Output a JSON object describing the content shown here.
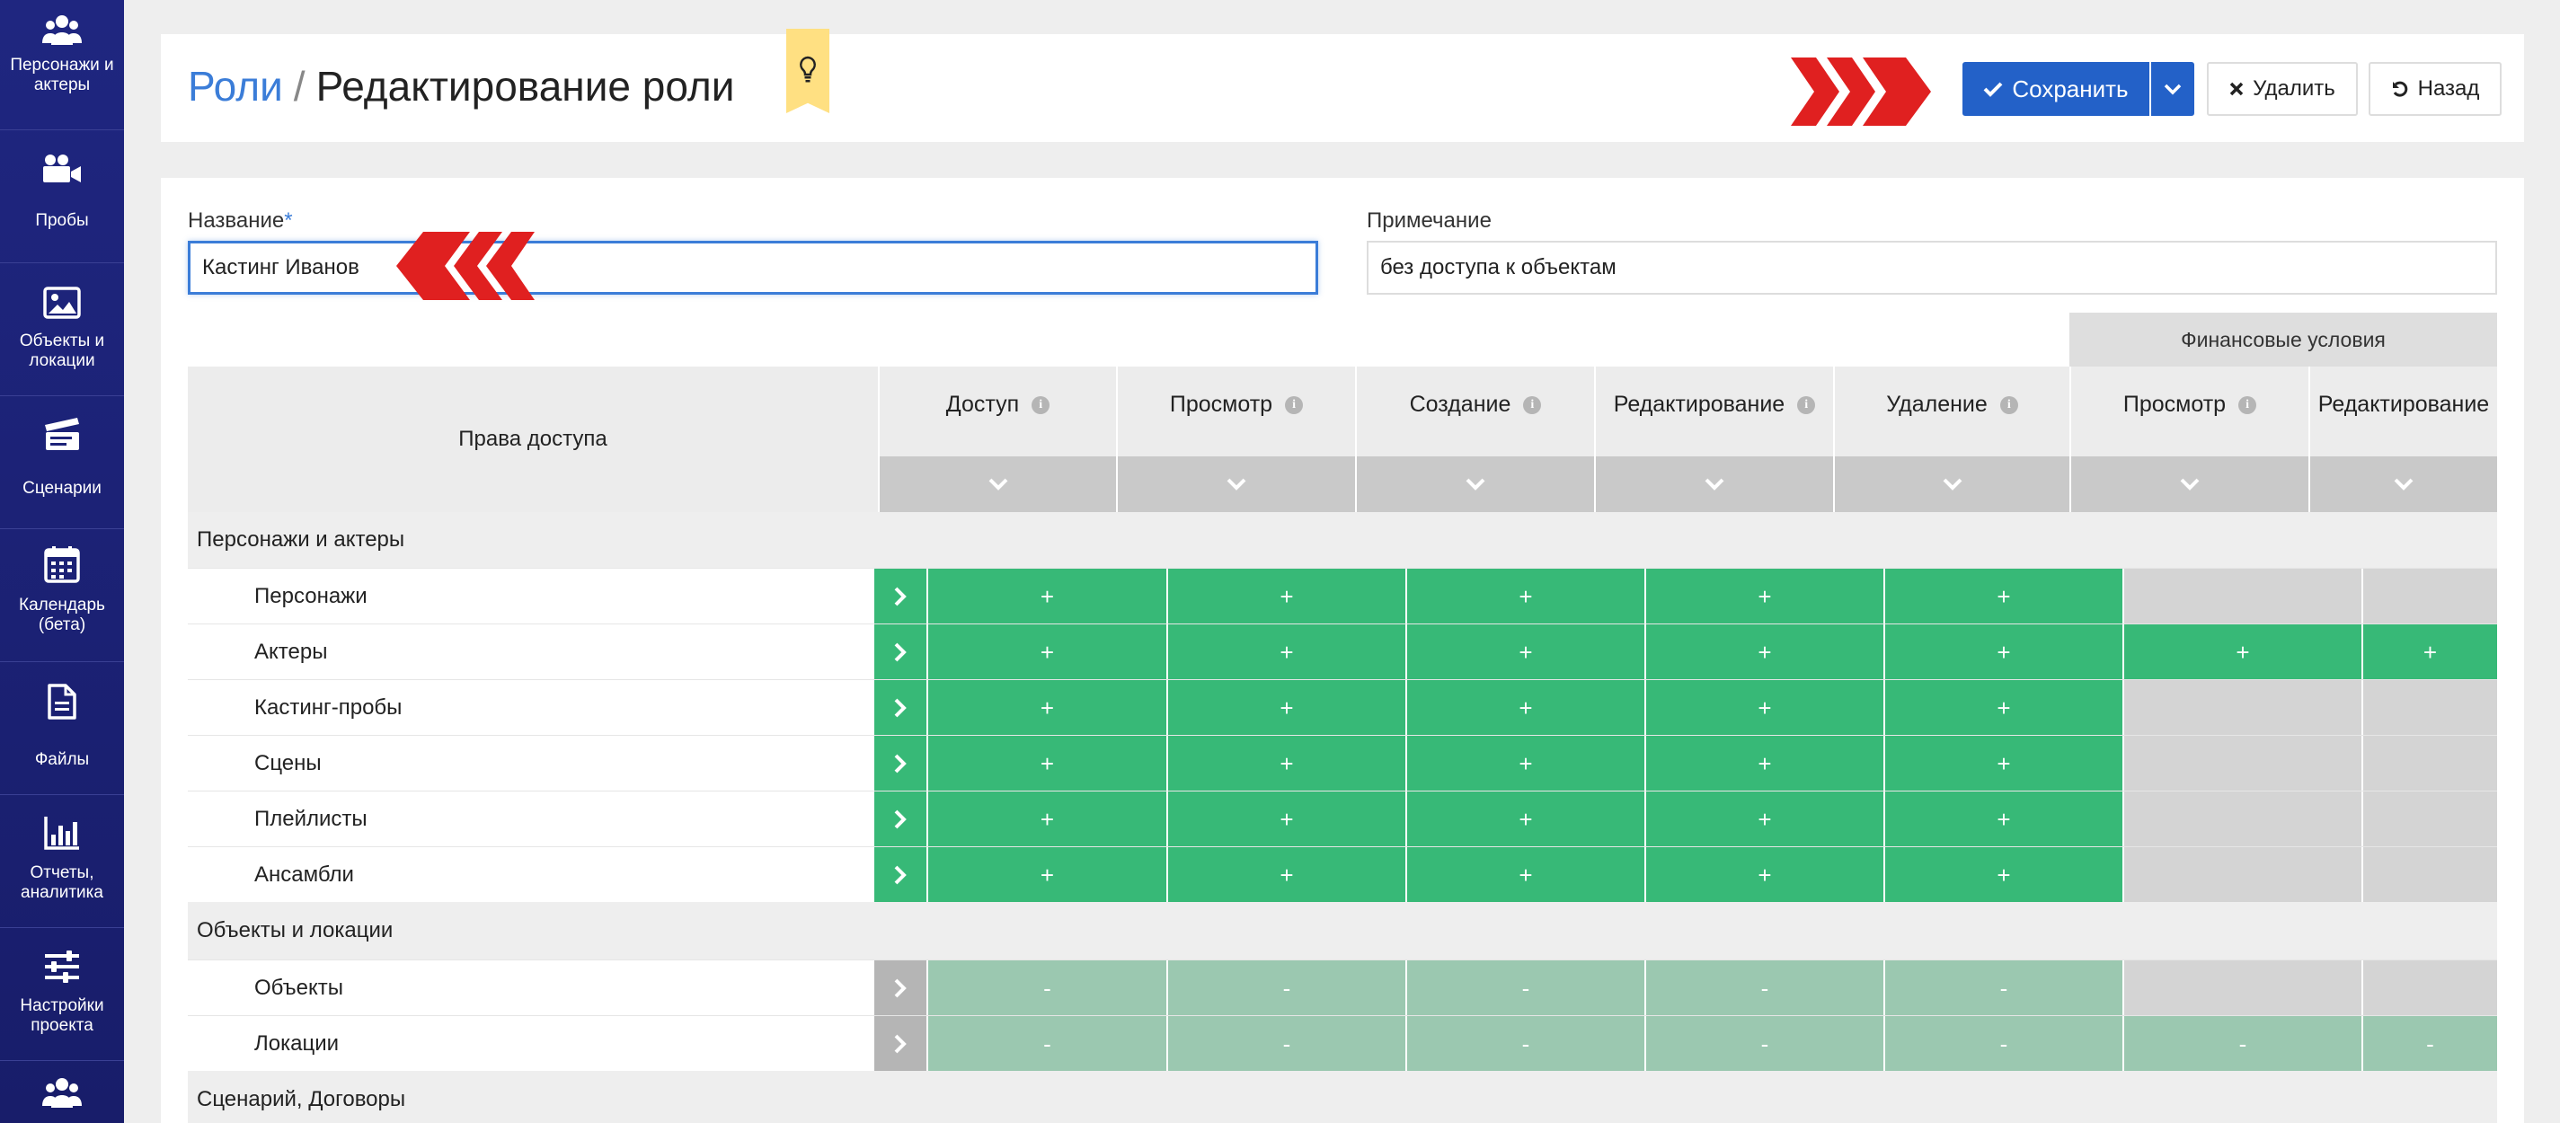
{
  "sidebar": {
    "items": [
      {
        "label_1": "Персонажи и",
        "label_2": "актеры",
        "icon": "users-icon"
      },
      {
        "label_1": "Пробы",
        "label_2": "",
        "icon": "video-camera-icon"
      },
      {
        "label_1": "Объекты и",
        "label_2": "локации",
        "icon": "image-icon"
      },
      {
        "label_1": "Сценарии",
        "label_2": "",
        "icon": "clapperboard-icon"
      },
      {
        "label_1": "Календарь",
        "label_2": "(бета)",
        "icon": "calendar-icon"
      },
      {
        "label_1": "Файлы",
        "label_2": "",
        "icon": "file-icon"
      },
      {
        "label_1": "Отчеты,",
        "label_2": "аналитика",
        "icon": "bar-chart-icon"
      },
      {
        "label_1": "Настройки",
        "label_2": "проекта",
        "icon": "sliders-icon"
      },
      {
        "label_1": "",
        "label_2": "",
        "icon": "users-icon"
      }
    ]
  },
  "header": {
    "breadcrumb_link": "Роли",
    "breadcrumb_sep": "/",
    "title": "Редактирование роли",
    "save_label": "Сохранить",
    "delete_label": "Удалить",
    "back_label": "Назад"
  },
  "form": {
    "name_label": "Название",
    "required_mark": "*",
    "name_value": "Кастинг Иванов",
    "note_label": "Примечание",
    "note_value": "без доступа к объектам"
  },
  "table": {
    "rights_header": "Права доступа",
    "financial_header": "Финансовые условия",
    "columns": [
      "Доступ",
      "Просмотр",
      "Создание",
      "Редактирование",
      "Удаление",
      "Просмотр",
      "Редактирование"
    ],
    "groups": [
      {
        "title": "Персонажи и актеры",
        "rows": [
          {
            "name": "Персонажи",
            "cells": [
              "+",
              "+",
              "+",
              "+",
              "+",
              "",
              ""
            ]
          },
          {
            "name": "Актеры",
            "cells": [
              "+",
              "+",
              "+",
              "+",
              "+",
              "+",
              "+"
            ]
          },
          {
            "name": "Кастинг-пробы",
            "cells": [
              "+",
              "+",
              "+",
              "+",
              "+",
              "",
              ""
            ]
          },
          {
            "name": "Сцены",
            "cells": [
              "+",
              "+",
              "+",
              "+",
              "+",
              "",
              ""
            ]
          },
          {
            "name": "Плейлисты",
            "cells": [
              "+",
              "+",
              "+",
              "+",
              "+",
              "",
              ""
            ]
          },
          {
            "name": "Ансамбли",
            "cells": [
              "+",
              "+",
              "+",
              "+",
              "+",
              "",
              ""
            ]
          }
        ]
      },
      {
        "title": "Объекты и локации",
        "rows": [
          {
            "name": "Объекты",
            "cells": [
              "-",
              "-",
              "-",
              "-",
              "-",
              "",
              ""
            ]
          },
          {
            "name": "Локации",
            "cells": [
              "-",
              "-",
              "-",
              "-",
              "-",
              "-",
              "-"
            ]
          }
        ]
      },
      {
        "title": "Сценарий, Договоры",
        "rows": []
      }
    ]
  },
  "colors": {
    "sidebar": "#1d2378",
    "accent": "#2361c8",
    "link": "#3b7dd8",
    "granted": "#37b977",
    "denied": "#9bc8b0",
    "arrow_red": "#e02020"
  }
}
